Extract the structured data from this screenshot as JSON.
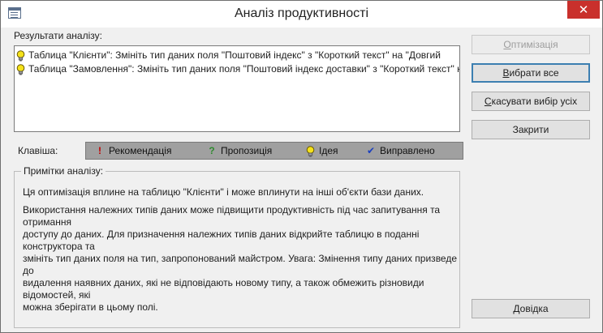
{
  "window": {
    "title": "Аналіз продуктивності",
    "close_glyph": "✕"
  },
  "results": {
    "label": "Результати аналізу:",
    "items": [
      {
        "icon": "idea-icon",
        "text": "Таблица \"Клієнти\": Змініть тип даних поля \"Поштовий індекс\" з \"Короткий текст\" на \"Довгий"
      },
      {
        "icon": "idea-icon",
        "text": "Таблица \"Замовлення\": Змініть тип даних поля \"Поштовий індекс доставки\" з \"Короткий текст\" на"
      }
    ]
  },
  "legend": {
    "label": "Клавіша:",
    "items": [
      {
        "icon": "recommendation-icon",
        "glyph": "!",
        "color": "#c00000",
        "text": "Рекомендація"
      },
      {
        "icon": "suggestion-icon",
        "glyph": "?",
        "color": "#2e8b2e",
        "text": "Пропозиція"
      },
      {
        "icon": "idea-icon",
        "glyph": "",
        "color": "#e8d000",
        "text": "Ідея"
      },
      {
        "icon": "fixed-icon",
        "glyph": "✔",
        "color": "#1a3fbf",
        "text": "Виправлено"
      }
    ]
  },
  "notes": {
    "label": "Примітки аналізу:",
    "paragraph1": "Ця оптимізація вплине на таблицю \"Клієнти\" і може вплинути на інші об'єкти бази даних.",
    "paragraph2_lines": [
      "Використання належних типів даних може підвищити продуктивність під час запитування та отримання",
      "доступу до даних. Для призначення належних типів даних відкрийте таблицю в поданні конструктора та",
      "змініть тип даних поля на тип, запропонований майстром. Увага: Змінення типу даних призведе до",
      "видалення наявних даних, які не відповідають новому типу, а також обмежить різновиди відомостей, які",
      "можна зберігати в цьому полі."
    ]
  },
  "buttons": {
    "optimize": {
      "u": "О",
      "rest": "птимізація"
    },
    "select_all": {
      "u": "В",
      "rest": "ибрати все"
    },
    "deselect_all": {
      "u": "С",
      "rest": "касувати вибір усіх"
    },
    "close": "Закрити",
    "help": "Довідка"
  }
}
